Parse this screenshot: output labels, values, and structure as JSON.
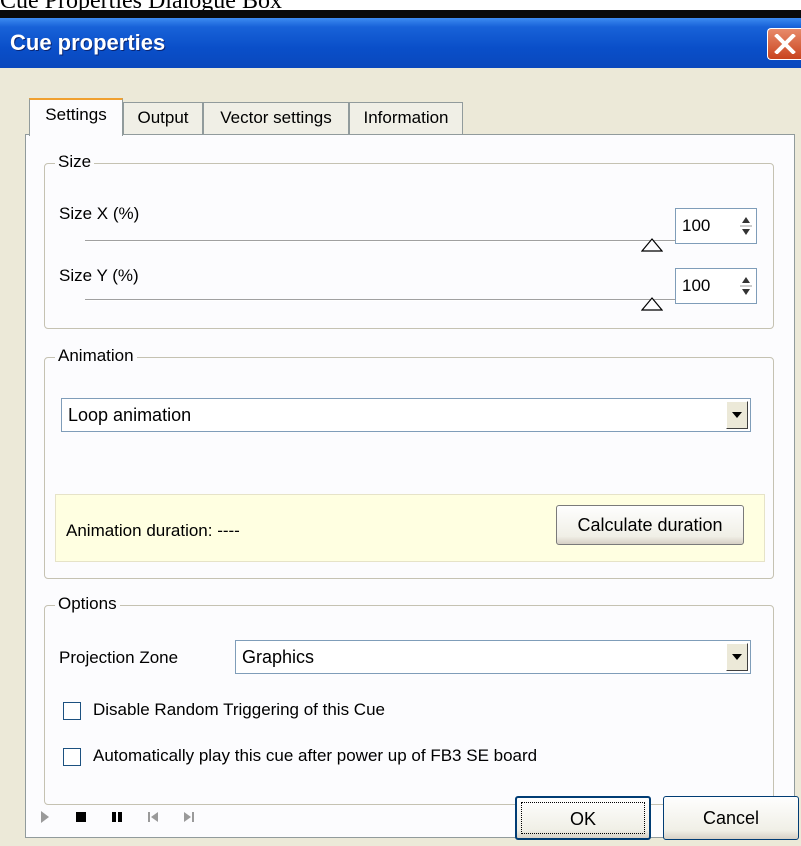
{
  "page_caption": "Cue Properties Dialogue Box",
  "window": {
    "title": "Cue properties"
  },
  "tabs": [
    {
      "label": "Settings",
      "active": true
    },
    {
      "label": "Output",
      "active": false
    },
    {
      "label": "Vector settings",
      "active": false
    },
    {
      "label": "Information",
      "active": false
    }
  ],
  "size_group": {
    "title": "Size",
    "size_x": {
      "label": "Size X (%)",
      "value": "100",
      "slider_level_percent": 100
    },
    "size_y": {
      "label": "Size Y (%)",
      "value": "100",
      "slider_level_percent": 100
    }
  },
  "animation_group": {
    "title": "Animation",
    "mode_selected": "Loop animation",
    "duration_label": "Animation duration: ----",
    "calculate_button": "Calculate duration"
  },
  "options_group": {
    "title": "Options",
    "projection_zone_label": "Projection Zone",
    "projection_zone_value": "Graphics",
    "disable_random_label": "Disable Random Triggering of this Cue",
    "disable_random_checked": false,
    "autoplay_label": "Automatically play this cue after power up of FB3 SE board",
    "autoplay_checked": false
  },
  "footer": {
    "ok_label": "OK",
    "cancel_label": "Cancel"
  },
  "colors": {
    "title_bar": "#0a4fc9",
    "window_bg": "#ece9d8",
    "info_bg": "#ffffe1",
    "close_button": "#c9441f"
  },
  "icons": [
    "close-icon",
    "play-icon",
    "stop-icon",
    "pause-icon",
    "skip-start-icon",
    "skip-end-icon",
    "chevron-down-icon"
  ]
}
